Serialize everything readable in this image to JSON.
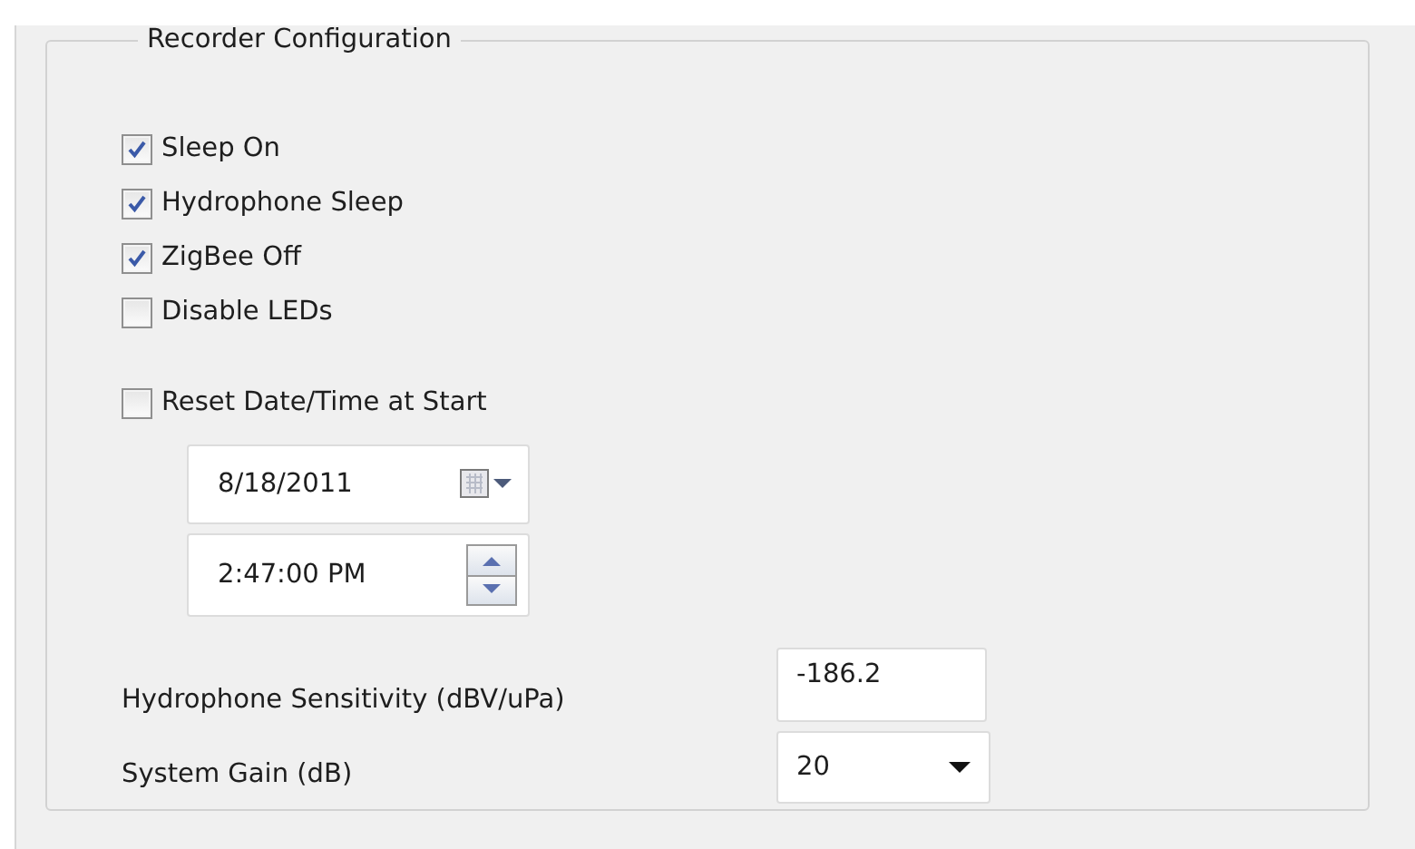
{
  "group": {
    "title": "Recorder Configuration"
  },
  "checkboxes": [
    {
      "label": "Sleep On",
      "checked": true
    },
    {
      "label": "Hydrophone Sleep",
      "checked": true
    },
    {
      "label": "ZigBee Off",
      "checked": true
    },
    {
      "label": "Disable LEDs",
      "checked": false
    }
  ],
  "reset": {
    "label": "Reset Date/Time at Start",
    "checked": false
  },
  "date_field": {
    "value": "8/18/2011"
  },
  "time_field": {
    "value": "2:47:00 PM"
  },
  "settings": [
    {
      "kind": "text",
      "label": "Hydrophone Sensitivity (dBV/uPa)",
      "value": "-186.2"
    },
    {
      "kind": "dropdown",
      "label": "System Gain (dB)",
      "value": "20"
    }
  ]
}
